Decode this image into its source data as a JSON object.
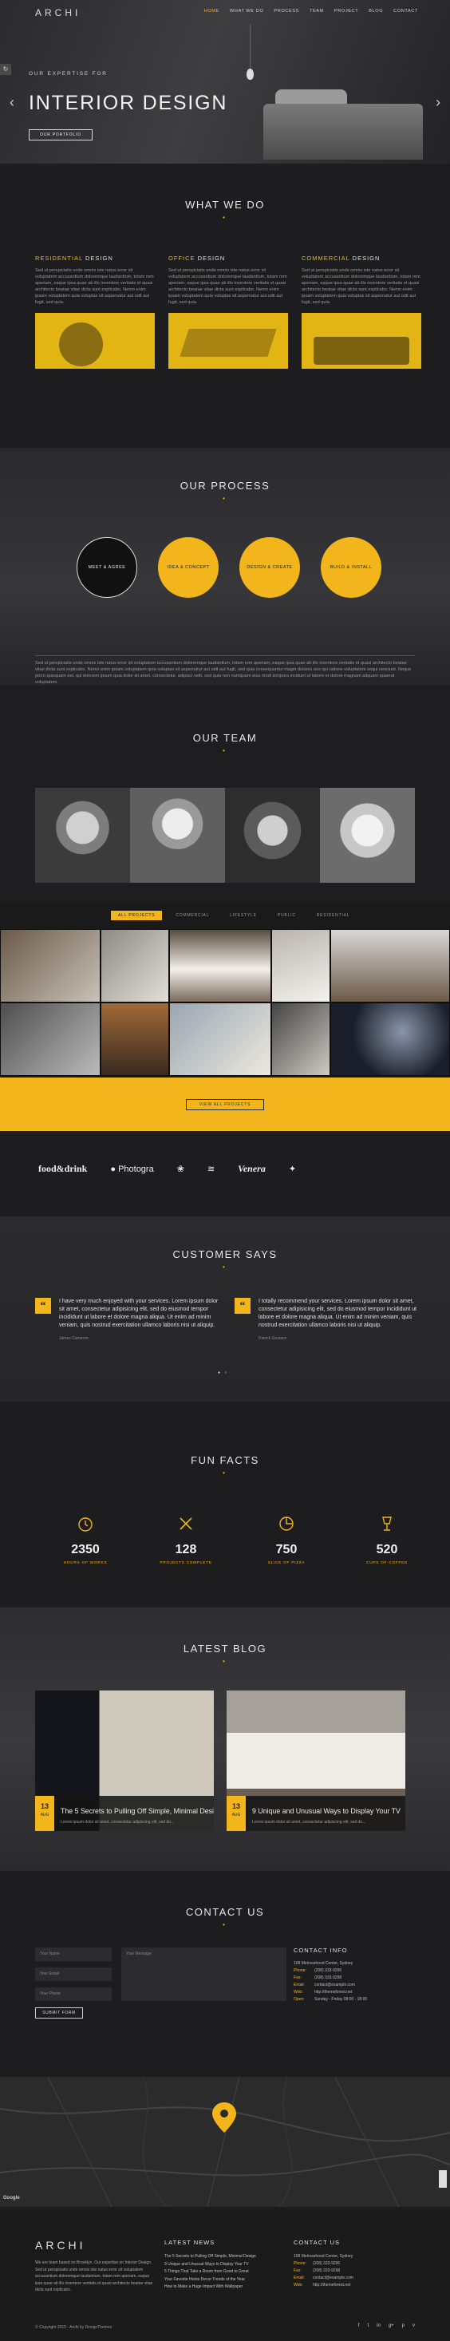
{
  "brand": "ARCHI",
  "nav": {
    "items": [
      "HOME",
      "WHAT WE DO",
      "PROCESS",
      "TEAM",
      "PROJECT",
      "BLOG",
      "CONTACT"
    ]
  },
  "hero": {
    "subtitle": "OUR EXPERTISE FOR",
    "title": "INTERIOR DESIGN",
    "button": "OUR PORTFOLIO"
  },
  "what_we_do": {
    "title": "WHAT WE DO",
    "services": [
      {
        "highlight": "RESIDENTIAL",
        "rest": " DESIGN",
        "text": "Sed ut perspiciatis unde omnis iste natus error sit voluptatem accusantium doloremque laudantium, totam rem aperiam, eaque ipsa quae ab illo inventore veritatis et quasi architecto beatae vitae dicta sunt explicabo. Nemo enim ipsam voluptatem quia voluptas sit aspernatur aut odit aut fugit, sed quia."
      },
      {
        "highlight": "OFFICE",
        "rest": " DESIGN",
        "text": "Sed ut perspiciatis unde omnis iste natus error sit voluptatem accusantium doloremque laudantium, totam rem aperiam, eaque ipsa quae ab illo inventore veritatis et quasi architecto beatae vitae dicta sunt explicabo. Nemo enim ipsam voluptatem quia voluptas sit aspernatur aut odit aut fugit, sed quia."
      },
      {
        "highlight": "COMMERCIAL",
        "rest": " DESIGN",
        "text": "Sed ut perspiciatis unde omnis iste natus error sit voluptatem accusantium doloremque laudantium, totam rem aperiam, eaque ipsa quae ab illo inventore veritatis et quasi architecto beatae vitae dicta sunt explicabo. Nemo enim ipsam voluptatem quia voluptas sit aspernatur aut odit aut fugit, sed quia."
      }
    ]
  },
  "process": {
    "title": "OUR PROCESS",
    "steps": [
      "MEET & AGREE",
      "IDEA & CONCEPT",
      "DESIGN & CREATE",
      "BUILD & INSTALL"
    ],
    "text": "Sed ut perspiciatis unde omnis iste natus error sit voluptatem accusantium doloremque laudantium, totam rem aperiam, eaque ipsa quae ab illo inventore veritatis et quasi architecto beatae vitae dicta sunt explicabo. Nemo enim ipsam voluptatem quia voluptas sit aspernatur aut odit aut fugit, sed quia consequuntur magni dolores eos qui ratione voluptatem sequi nesciunt. Neque porro quisquam est, qui dolorem ipsum quia dolor sit amet, consectetur, adipisci velit, sed quia non numquam eius modi tempora incidunt ut labore et dolore magnam aliquam quaerat voluptatem."
  },
  "team": {
    "title": "OUR TEAM"
  },
  "portfolio": {
    "filters": [
      "ALL PROJECTS",
      "COMMERCIAL",
      "LIFESTYLE",
      "PUBLIC",
      "RESIDENTIAL"
    ],
    "button": "VIEW ALL PROJECTS"
  },
  "clients": {
    "logos": [
      "food&drink",
      "Photogra",
      "",
      "",
      "Venera",
      ""
    ]
  },
  "testimonials": {
    "title": "CUSTOMER SAYS",
    "items": [
      {
        "text": "I have very much enjoyed with your services. Lorem ipsum dolor sit amet, consectetur adipisicing elit, sed do eiusmod tempor incididunt ut labore et dolore magna aliqua. Ut enim ad minim veniam, quis nostrud exercitation ullamco laboris nisi ut aliquip.",
        "author": "James Cameron"
      },
      {
        "text": "I totally recommend your services. Lorem ipsum dolor sit amet, consectetur adipisicing elit, sed do eiusmod tempor incididunt ut labore et dolore magna aliqua. Ut enim ad minim veniam, quis nostrud exercitation ullamco laboris nisi ut aliquip.",
        "author": "Patrick Gustavo"
      }
    ]
  },
  "facts": {
    "title": "FUN FACTS",
    "items": [
      {
        "num": "2350",
        "label": "HOURS OF WORKS"
      },
      {
        "num": "128",
        "label": "PROJECTS COMPLETE"
      },
      {
        "num": "750",
        "label": "SLICE OF PIZZA"
      },
      {
        "num": "520",
        "label": "CUPS OF COFFEE"
      }
    ]
  },
  "blog": {
    "title": "LATEST BLOG",
    "posts": [
      {
        "day": "13",
        "month": "AUG",
        "title": "The 5 Secrets to Pulling Off Simple, Minimal Design",
        "excerpt": "Lorem ipsum dolor sit amet, consectetur adipiscing elit, sed do..."
      },
      {
        "day": "13",
        "month": "AUG",
        "title": "9 Unique and Unusual Ways to Display Your TV",
        "excerpt": "Lorem ipsum dolor sit amet, consectetur adipiscing elit, sed do..."
      }
    ]
  },
  "contact": {
    "title": "CONTACT US",
    "name_placeholder": "Your Name",
    "email_placeholder": "Your Email",
    "phone_placeholder": "Your Phone",
    "message_placeholder": "Your Message",
    "submit": "SUBMIT FORM",
    "info_title": "CONTACT INFO",
    "address": "108 Melrosehood Center, Sydney",
    "rows": [
      {
        "k": "Phone:",
        "v": "(208) 333-9296"
      },
      {
        "k": "Fax:",
        "v": "(208) 333-9298"
      },
      {
        "k": "Email:",
        "v": "contact@example.com"
      },
      {
        "k": "Web:",
        "v": "http://themeforest.net"
      },
      {
        "k": "Open:",
        "v": "Sunday - Friday 08:00 - 18:00"
      }
    ]
  },
  "footer": {
    "brand": "ARCHI",
    "about": "We are team based on Brooklyn. Our expertise on Interior Design. Sed ut perspiciatis unde omnis iste natus error sit voluptatem accusantium doloremque laudantium, totam rem aperiam, eaque ipsa quae ab illo inventore veritatis et quasi architecto beatae vitae dicta sunt explicabo.",
    "news_title": "LATEST NEWS",
    "news": [
      "The 5 Secrets to Pulling Off Simple, Minimal Design",
      "9 Unique and Unusual Ways to Display Your TV",
      "5 Things That Take a Room from Good to Great",
      "Your Favorite Home Decor Trends of the Year",
      "How to Make a Huge Impact With Wallpaper"
    ],
    "info_title": "CONTACT US",
    "address": "108 Melrosehood Center, Sydney",
    "rows": [
      {
        "k": "Phone:",
        "v": "(208) 333-9296"
      },
      {
        "k": "Fax:",
        "v": "(208) 333-9298"
      },
      {
        "k": "Email:",
        "v": "contact@example.com"
      },
      {
        "k": "Web:",
        "v": "http://themeforest.net"
      }
    ],
    "copyright": "© Copyright 2015 - Archi by DesignThemes",
    "socials": [
      "f",
      "t",
      "in",
      "g+",
      "p",
      "v"
    ]
  },
  "colors": {
    "accent": "#f2b51b",
    "bg": "#1d1d1f"
  }
}
